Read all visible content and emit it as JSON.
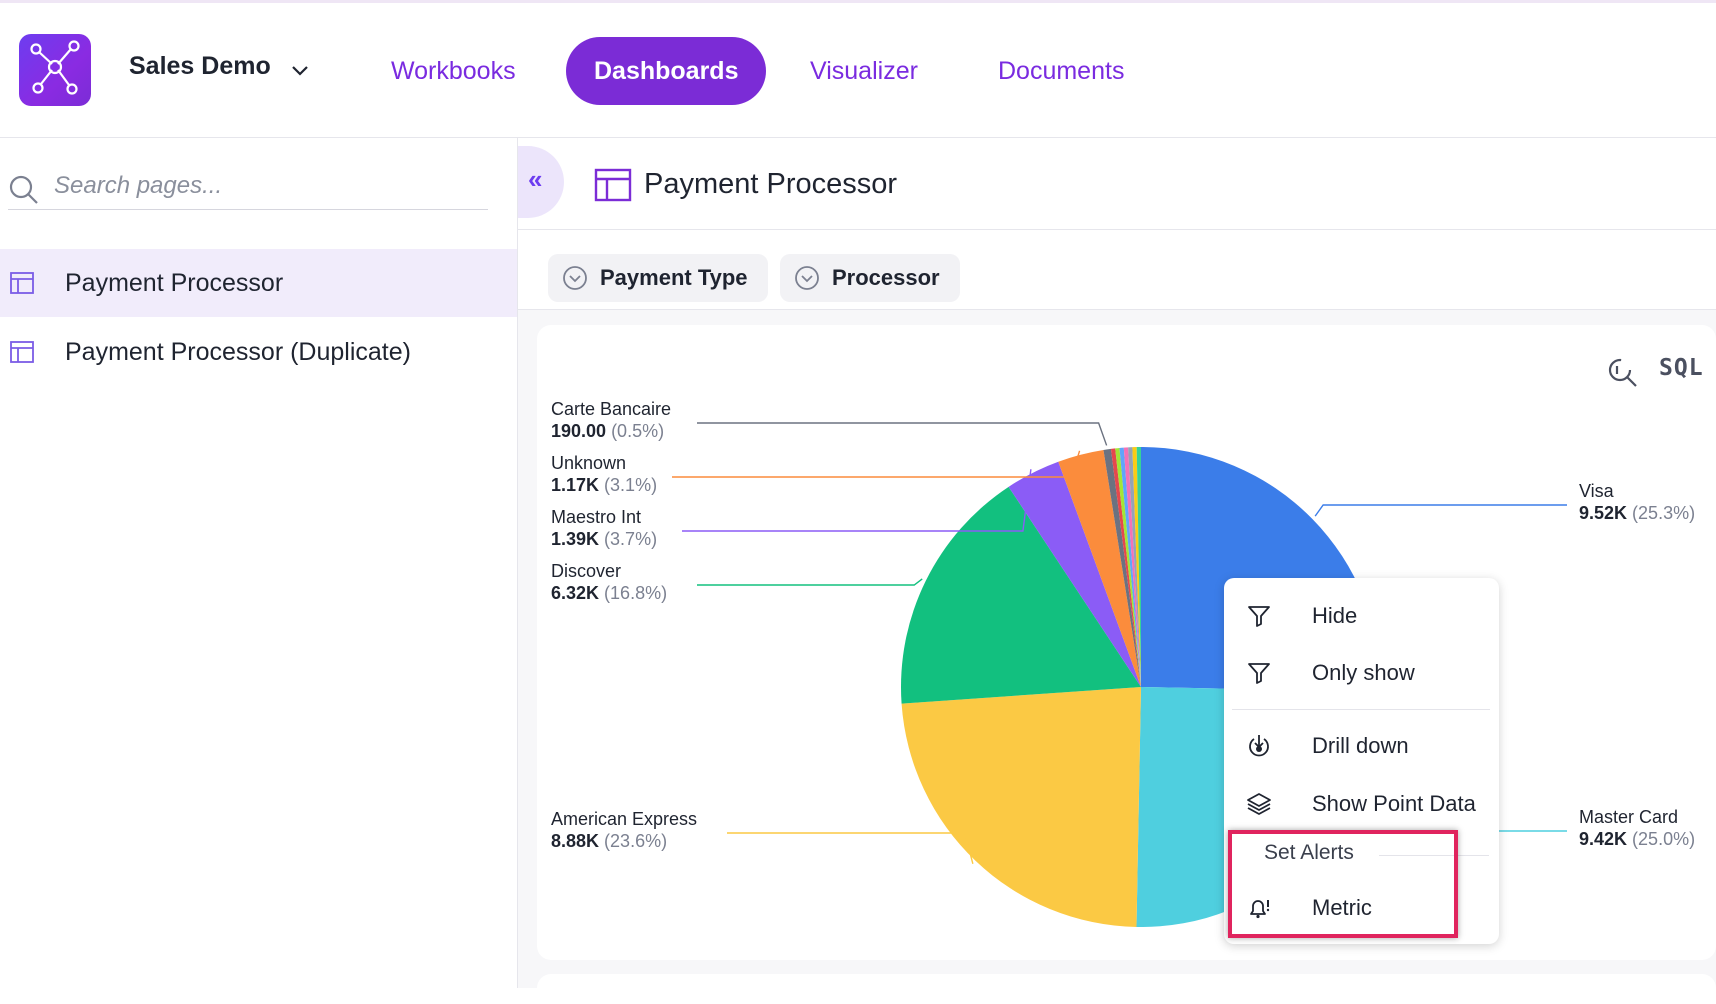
{
  "header": {
    "workspace_name": "Sales Demo",
    "nav": [
      "Workbooks",
      "Dashboards",
      "Visualizer",
      "Documents"
    ],
    "active_nav": "Dashboards"
  },
  "sidebar": {
    "search_placeholder": "Search pages...",
    "pages": [
      {
        "label": "Payment Processor",
        "selected": true
      },
      {
        "label": "Payment Processor (Duplicate)",
        "selected": false
      }
    ]
  },
  "page": {
    "title": "Payment Processor",
    "filters": [
      "Payment Type",
      "Processor"
    ],
    "tools": {
      "sql_label": "SQL"
    }
  },
  "chart_data": {
    "type": "pie",
    "slices": [
      {
        "label": "Visa",
        "value_text": "9.52K",
        "pct_text": "(25.3%)",
        "value": 9520,
        "pct": 25.3,
        "color": "#3b7de9"
      },
      {
        "label": "Master Card",
        "value_text": "9.42K",
        "pct_text": "(25.0%)",
        "value": 9420,
        "pct": 25.0,
        "color": "#4fcfdf"
      },
      {
        "label": "American Express",
        "value_text": "8.88K",
        "pct_text": "(23.6%)",
        "value": 8880,
        "pct": 23.6,
        "color": "#fbc944"
      },
      {
        "label": "Discover",
        "value_text": "6.32K",
        "pct_text": "(16.8%)",
        "value": 6320,
        "pct": 16.8,
        "color": "#12c07f"
      },
      {
        "label": "Maestro Int",
        "value_text": "1.39K",
        "pct_text": "(3.7%)",
        "value": 1390,
        "pct": 3.7,
        "color": "#8b5cf6"
      },
      {
        "label": "Unknown",
        "value_text": "1.17K",
        "pct_text": "(3.1%)",
        "value": 1170,
        "pct": 3.1,
        "color": "#fb8c3c"
      },
      {
        "label": "Carte Bancaire",
        "value_text": "190.00",
        "pct_text": "(0.5%)",
        "value": 190,
        "pct": 0.5,
        "color": "#6b7280"
      }
    ]
  },
  "context_menu": {
    "items": [
      "Hide",
      "Only show",
      "Drill down",
      "Show Point Data"
    ],
    "group_label": "Set Alerts",
    "group_items": [
      "Metric"
    ]
  }
}
